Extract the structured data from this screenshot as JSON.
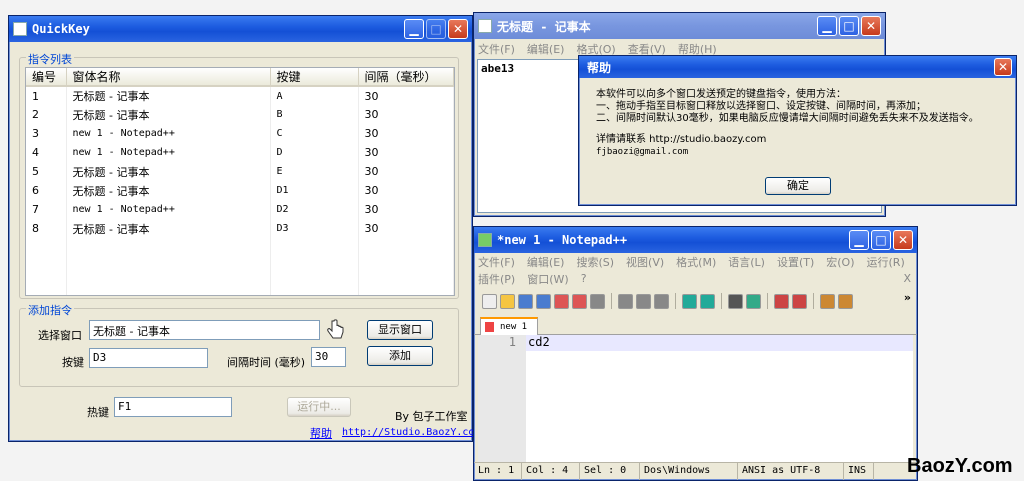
{
  "quickkey": {
    "title": "QuickKey",
    "list_group": "指令列表",
    "columns": [
      "编号",
      "窗体名称",
      "按键",
      "间隔（毫秒）"
    ],
    "rows": [
      [
        "1",
        "无标题 - 记事本",
        "A",
        "30"
      ],
      [
        "2",
        "无标题 - 记事本",
        "B",
        "30"
      ],
      [
        "3",
        "new  1 - Notepad++",
        "C",
        "30"
      ],
      [
        "4",
        "new  1 - Notepad++",
        "D",
        "30"
      ],
      [
        "5",
        "无标题 - 记事本",
        "E",
        "30"
      ],
      [
        "6",
        "无标题 - 记事本",
        "D1",
        "30"
      ],
      [
        "7",
        "new  1 - Notepad++",
        "D2",
        "30"
      ],
      [
        "8",
        "无标题 - 记事本",
        "D3",
        "30"
      ]
    ],
    "add_group": "添加指令",
    "select_window_label": "选择窗口",
    "select_window_value": "无标题 - 记事本",
    "show_window_button": "显示窗口",
    "key_label": "按键",
    "key_value": "D3",
    "interval_label": "间隔时间 (毫秒)",
    "interval_value": "30",
    "add_button": "添加",
    "hotkey_label": "热键",
    "hotkey_value": "F1",
    "run_button": "运行中...",
    "credit": "By 包子工作室",
    "help_link": "帮助",
    "site_link": "http://Studio.BaozY.com"
  },
  "notepad": {
    "title": "无标题 - 记事本",
    "menu": [
      "文件(F)",
      "编辑(E)",
      "格式(O)",
      "查看(V)",
      "帮助(H)"
    ],
    "content": "abe13"
  },
  "help_dialog": {
    "title": "帮助",
    "lines": [
      "本软件可以向多个窗口发送预定的键盘指令，使用方法：",
      "一、拖动手指至目标窗口释放以选择窗口、设定按键、间隔时间，再添加；",
      "二、间隔时间默认30毫秒，如果电脑反应慢请增大间隔时间避免丢失来不及发送指令。"
    ],
    "contact": "详情请联系 http://studio.baozy.com",
    "email": "fjbaozi@gmail.com",
    "ok_button": "确定"
  },
  "notepadpp": {
    "title": "*new  1 - Notepad++",
    "menu1": [
      "文件(F)",
      "编辑(E)",
      "搜索(S)",
      "视图(V)",
      "格式(M)",
      "语言(L)",
      "设置(T)",
      "宏(O)",
      "运行(R)"
    ],
    "menu2": [
      "插件(P)",
      "窗口(W)",
      "?"
    ],
    "close_x": "X",
    "more": "»",
    "tab_label": "new  1",
    "line_number": "1",
    "line_text": "cd2",
    "status": [
      "Ln : 1",
      "Col : 4",
      "Sel : 0",
      "Dos\\Windows",
      "ANSI as UTF-8",
      "INS"
    ]
  },
  "watermark": "BaozY.com"
}
